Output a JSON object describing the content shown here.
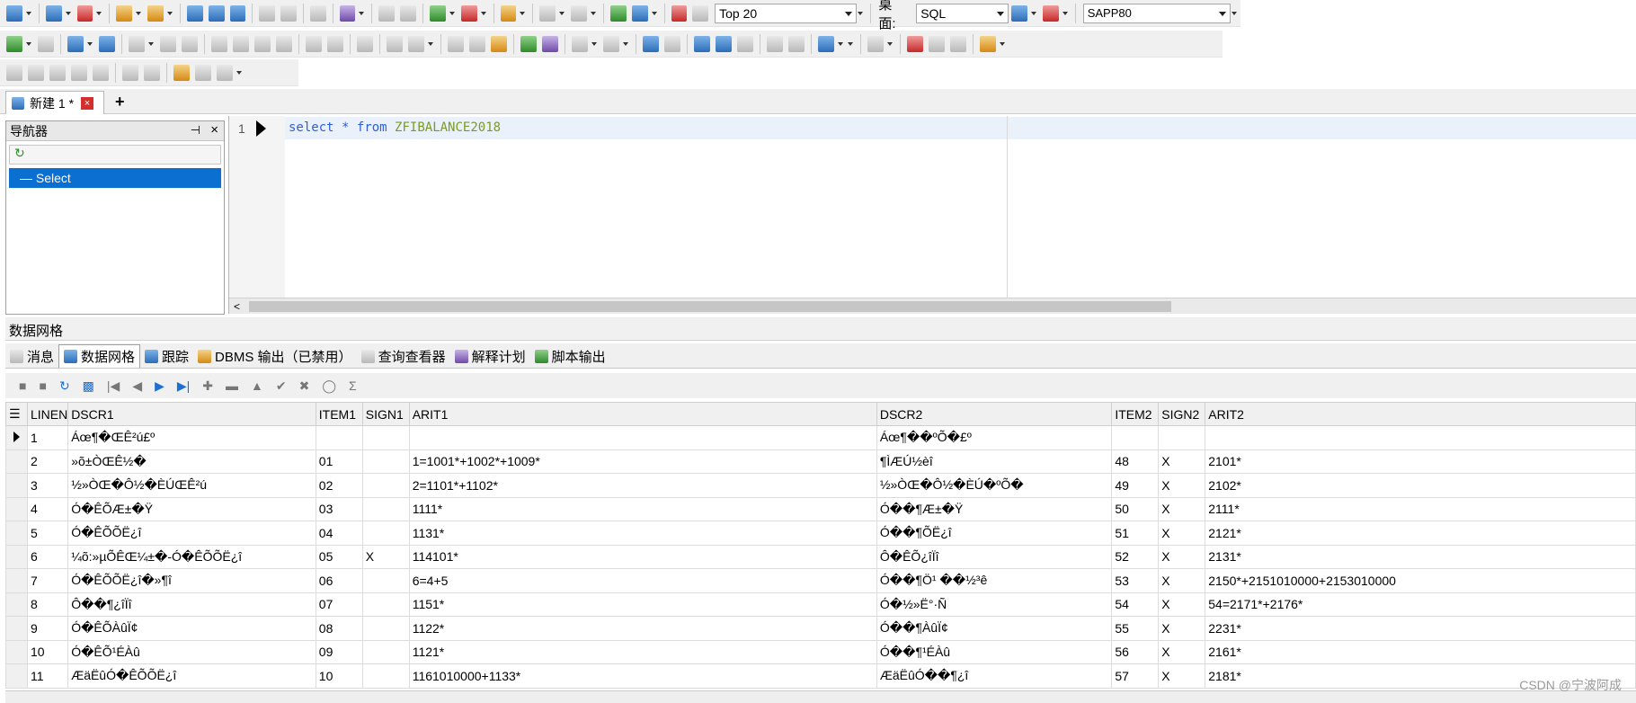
{
  "toolbar": {
    "top_n": "Top 20",
    "desktop_label": "桌面:",
    "desktop_value": "SQL",
    "connection": "SAPP80"
  },
  "tab": {
    "title": "新建 1 *",
    "close": "×",
    "add": "+"
  },
  "navigator": {
    "title": "导航器",
    "pin": "⊣",
    "close": "×",
    "refresh": "↻",
    "item": "— Select"
  },
  "editor": {
    "line": "1",
    "keywords": [
      "select",
      "*",
      "from"
    ],
    "table": "ZFIBALANCE2018"
  },
  "panel": {
    "title": "数据网格"
  },
  "panel_tabs": [
    "消息",
    "数据网格",
    "跟踪",
    "DBMS 输出（已禁用）",
    "查询查看器",
    "解释计划",
    "脚本输出"
  ],
  "grid": {
    "columns": [
      "LINEN",
      "DSCR1",
      "ITEM1",
      "SIGN1",
      "ARIT1",
      "DSCR2",
      "ITEM2",
      "SIGN2",
      "ARIT2"
    ],
    "rows": [
      [
        "1",
        "Áœ¶�ŒÊ²ú£º",
        "",
        "",
        "",
        "Áœ¶��ºÕ�£º",
        "",
        "",
        ""
      ],
      [
        "2",
        " »õ±ÒŒÊ½�",
        "01",
        "",
        "1=1001*+1002*+1009*",
        " ¶ÌÆÚ½èî",
        "48",
        "X",
        "2101*"
      ],
      [
        "3",
        " ½»ÒŒ�Ô½�ÈÚŒÊ²ú",
        "02",
        "",
        "2=1101*+1102*",
        " ½»ÒŒ�Ô½�ÈÚ�ºÕ�",
        "49",
        "X",
        "2102*"
      ],
      [
        "4",
        " Ó�ÊÕÆ±�Ÿ",
        "03",
        "",
        "1111*",
        " Ó��¶Æ±�Ÿ",
        "50",
        "X",
        "2111*"
      ],
      [
        "5",
        " Ó�ÊÕÕË¿î",
        "04",
        "",
        "1131*",
        " Ó��¶ÕË¿î",
        "51",
        "X",
        "2121*"
      ],
      [
        "6",
        "   ¼õ:»µÕÊŒ¼±�-Ó�ÊÕÕË¿î",
        "05",
        "X",
        "114101*",
        " Ô�ÊÕ¿îÏî",
        "52",
        "X",
        "2131*"
      ],
      [
        "7",
        " Ó�ÊÕÕË¿î�»¶î",
        "06",
        "",
        "6=4+5",
        " Ó��¶Ö¹ ��½³ê",
        "53",
        "X",
        "2150*+2151010000+2153010000"
      ],
      [
        "8",
        " Ô��¶¿îÏî",
        "07",
        "",
        "1151*",
        " Ó�½»Ë°·Ñ",
        "54",
        "X",
        "54=2171*+2176*"
      ],
      [
        "9",
        " Ó�ÊÕÀûÏ¢",
        "08",
        "",
        "1122*",
        " Ó��¶ÀûÏ¢",
        "55",
        "X",
        "2231*"
      ],
      [
        "10",
        " Ó�ÊÕ¹ÉÀû",
        "09",
        "",
        "1121*",
        " Ó��¶¹ÉÀû",
        "56",
        "X",
        "2161*"
      ],
      [
        "11",
        " ÆäËûÓ�ÊÕÕË¿î",
        "10",
        "",
        "1161010000+1133*",
        " ÆäËûÓ��¶¿î",
        "57",
        "X",
        "2181*"
      ]
    ]
  },
  "watermark": "CSDN @宁波阿成"
}
